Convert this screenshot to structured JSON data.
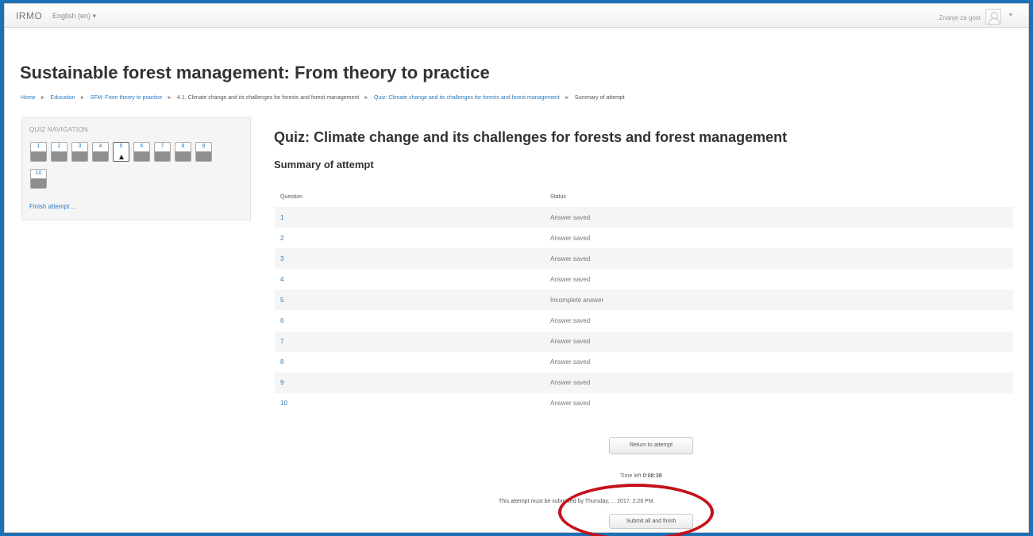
{
  "navbar": {
    "brand": "IRMO",
    "language": "English (en) ▾",
    "login_info": "Znanje za gost",
    "user_caret": "▾"
  },
  "page": {
    "title": "Sustainable forest management: From theory to practice"
  },
  "breadcrumb": [
    {
      "label": "Home",
      "link": true
    },
    {
      "label": "Education",
      "link": true
    },
    {
      "label": "SFM: From theory to practice",
      "link": true
    },
    {
      "label": "4.1. Climate change and its challenges for forests and forest management",
      "link": false
    },
    {
      "label": "Quiz: Climate change and its challenges for forests and forest management",
      "link": true
    },
    {
      "label": "Summary of attempt",
      "link": false
    }
  ],
  "breadcrumb_separator": "►",
  "quiz_nav": {
    "heading": "QUIZ NAVIGATION",
    "buttons": [
      {
        "label": "1",
        "state": "answered"
      },
      {
        "label": "2",
        "state": "answered"
      },
      {
        "label": "3",
        "state": "answered"
      },
      {
        "label": "4",
        "state": "answered"
      },
      {
        "label": "5",
        "state": "current"
      },
      {
        "label": "6",
        "state": "answered"
      },
      {
        "label": "7",
        "state": "answered"
      },
      {
        "label": "8",
        "state": "answered"
      },
      {
        "label": "9",
        "state": "answered"
      },
      {
        "label": "10",
        "state": "answered"
      }
    ],
    "finish_label": "Finish attempt ..."
  },
  "main": {
    "quiz_title": "Quiz: Climate change and its challenges for forests and forest management",
    "summary_heading": "Summary of attempt",
    "table": {
      "headers": [
        "Question",
        "Status"
      ],
      "rows": [
        {
          "q": "1",
          "status": "Answer saved"
        },
        {
          "q": "2",
          "status": "Answer saved"
        },
        {
          "q": "3",
          "status": "Answer saved"
        },
        {
          "q": "4",
          "status": "Answer saved"
        },
        {
          "q": "5",
          "status": "Incomplete answer"
        },
        {
          "q": "6",
          "status": "Answer saved"
        },
        {
          "q": "7",
          "status": "Answer saved"
        },
        {
          "q": "8",
          "status": "Answer saved"
        },
        {
          "q": "9",
          "status": "Answer saved"
        },
        {
          "q": "10",
          "status": "Answer saved"
        }
      ]
    },
    "return_label": "Return to attempt",
    "time_left_label": "Time left",
    "time_left_value": "0:08:38",
    "deadline_text": "This attempt must be submitted by Thursday, ... 2017, 2:26 PM.",
    "submit_label": "Submit all and finish"
  },
  "colors": {
    "accent_link": "#2a7bc2",
    "highlight": "#c4111a",
    "outer_background": "#1d6fb8"
  }
}
